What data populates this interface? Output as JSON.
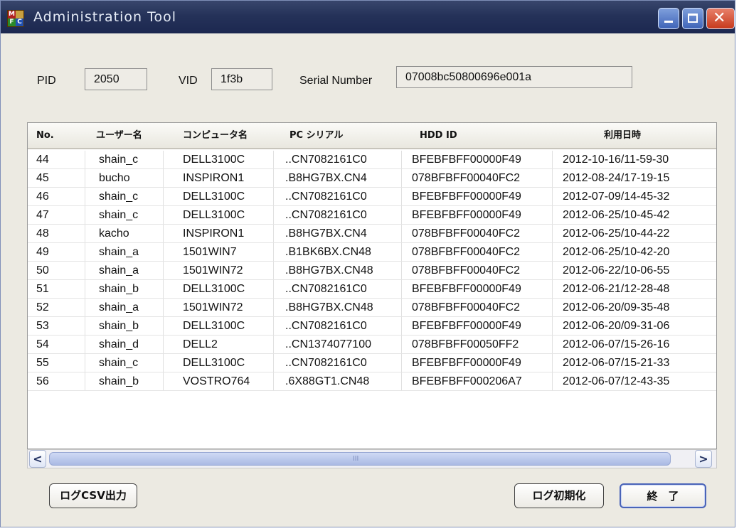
{
  "window": {
    "title": "Administration Tool",
    "icon_letters": [
      "M",
      "",
      "F",
      "C"
    ]
  },
  "titlebar_buttons": [
    "minimize-icon",
    "maximize-icon",
    "close-icon"
  ],
  "device": {
    "pid_label": "PID",
    "pid_value": "2050",
    "vid_label": "VID",
    "vid_value": "1f3b",
    "serial_label": "Serial Number",
    "serial_value": "07008bc50800696e001a"
  },
  "table": {
    "columns": [
      "No.",
      "ユーザー名",
      "コンピュータ名",
      "PC シリアル",
      "HDD ID",
      "利用日時"
    ],
    "rows": [
      [
        "44",
        "shain_c",
        "DELL3100C",
        "..CN7082161C0",
        "BFEBFBFF00000F49",
        "2012-10-16/11-59-30"
      ],
      [
        "45",
        "bucho",
        "INSPIRON1",
        ".B8HG7BX.CN4",
        "078BFBFF00040FC2",
        "2012-08-24/17-19-15"
      ],
      [
        "46",
        "shain_c",
        "DELL3100C",
        "..CN7082161C0",
        "BFEBFBFF00000F49",
        "2012-07-09/14-45-32"
      ],
      [
        "47",
        "shain_c",
        "DELL3100C",
        "..CN7082161C0",
        "BFEBFBFF00000F49",
        "2012-06-25/10-45-42"
      ],
      [
        "48",
        "kacho",
        "INSPIRON1",
        ".B8HG7BX.CN4",
        "078BFBFF00040FC2",
        "2012-06-25/10-44-22"
      ],
      [
        "49",
        "shain_a",
        "1501WIN7",
        ".B1BK6BX.CN48",
        "078BFBFF00040FC2",
        "2012-06-25/10-42-20"
      ],
      [
        "50",
        "shain_a",
        "1501WIN72",
        ".B8HG7BX.CN48",
        "078BFBFF00040FC2",
        "2012-06-22/10-06-55"
      ],
      [
        "51",
        "shain_b",
        "DELL3100C",
        "..CN7082161C0",
        "BFEBFBFF00000F49",
        "2012-06-21/12-28-48"
      ],
      [
        "52",
        "shain_a",
        "1501WIN72",
        ".B8HG7BX.CN48",
        "078BFBFF00040FC2",
        "2012-06-20/09-35-48"
      ],
      [
        "53",
        "shain_b",
        "DELL3100C",
        "..CN7082161C0",
        "BFEBFBFF00000F49",
        "2012-06-20/09-31-06"
      ],
      [
        "54",
        "shain_d",
        "DELL2",
        "..CN1374077100",
        "078BFBFF00050FF2",
        "2012-06-07/15-26-16"
      ],
      [
        "55",
        "shain_c",
        "DELL3100C",
        "..CN7082161C0",
        "BFEBFBFF00000F49",
        "2012-06-07/15-21-33"
      ],
      [
        "56",
        "shain_b",
        "VOSTRO764",
        ".6X88GT1.CN48",
        "BFEBFBFF000206A7",
        "2012-06-07/12-43-35"
      ]
    ]
  },
  "scroll": {
    "up": "∧",
    "down": "∨",
    "left": "<",
    "right": ">",
    "grip": "III"
  },
  "buttons": {
    "export_csv": "ログCSV出力",
    "initialize": "ログ初期化",
    "exit": "終　了"
  },
  "colors": {
    "titlebar": "#253259",
    "window_bg": "#eceae2",
    "close": "#c73a1d",
    "scrollbar": "#aab9e4"
  }
}
